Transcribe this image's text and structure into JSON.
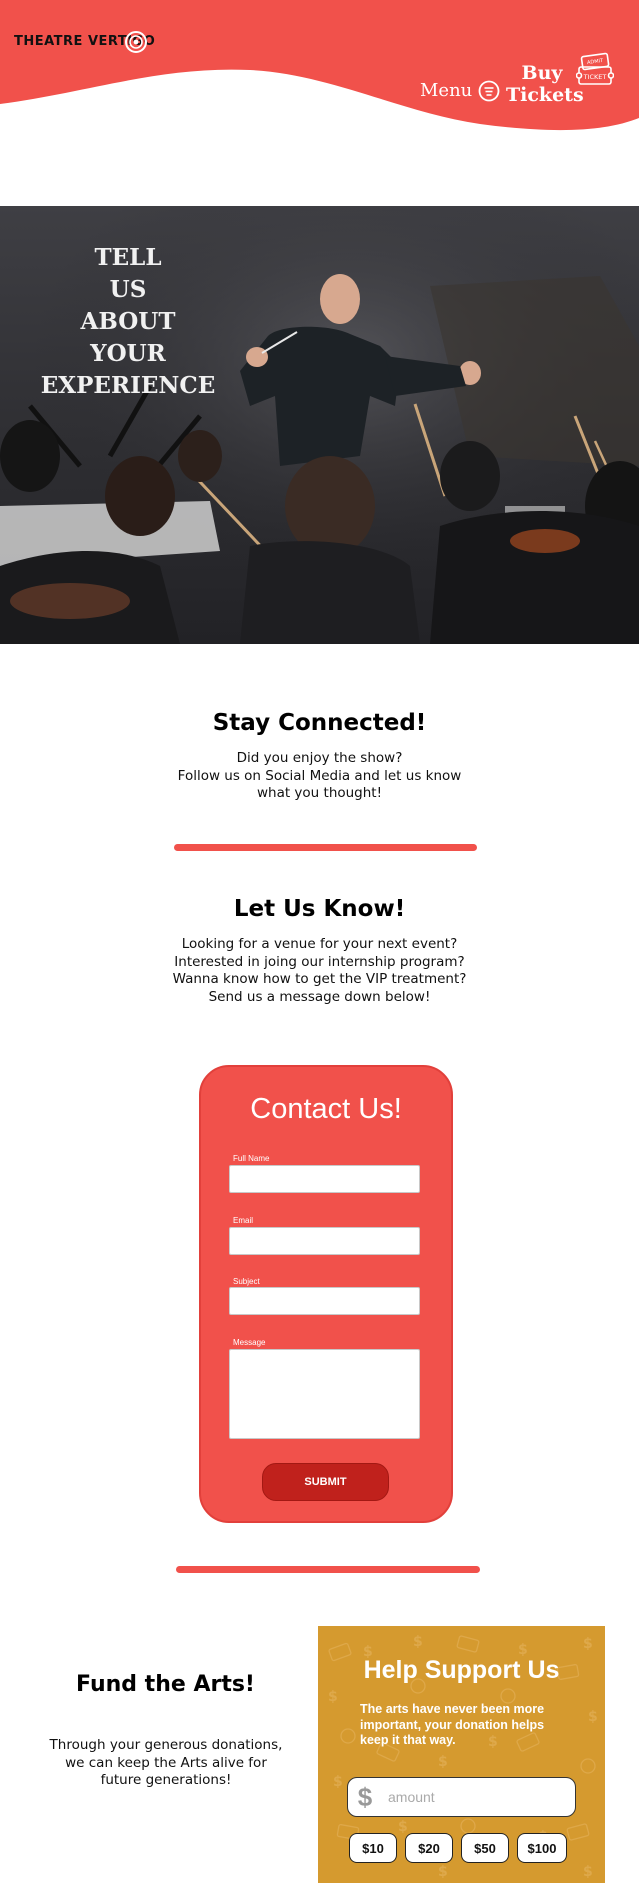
{
  "header": {
    "logo_text": "THEATRE VERTIGO",
    "menu_label": "Menu",
    "tickets_line1": "Buy",
    "tickets_line2": "Tickets",
    "ticket_icon_text_top": "ADMIT",
    "ticket_icon_text_bottom": "TICKET"
  },
  "hero": {
    "title_lines": [
      "TELL",
      "US",
      "ABOUT",
      "YOUR",
      "EXPERIENCE"
    ]
  },
  "stay_connected": {
    "heading": "Stay Connected!",
    "lines": [
      "Did you enjoy the show?",
      "Follow us on Social Media and let us know",
      "what you thought!"
    ]
  },
  "let_us_know": {
    "heading": "Let Us Know!",
    "lines": [
      "Looking for a venue for your next event?",
      "Interested in joing our internship program?",
      "Wanna know how to get the VIP treatment?",
      "Send us a message down below!"
    ]
  },
  "contact": {
    "heading": "Contact Us!",
    "full_name_label": "Full Name",
    "email_label": "Email",
    "subject_label": "Subject",
    "message_label": "Message",
    "submit_label": "SUBMIT"
  },
  "fund": {
    "heading": "Fund the Arts!",
    "lines": [
      "Through your generous donations,",
      "we can keep the Arts alive for",
      "future generations!"
    ]
  },
  "support": {
    "heading": "Help Support Us",
    "text": "The arts have never been more important, your donation helps keep it that way.",
    "currency_symbol": "$",
    "amount_placeholder": "amount",
    "amounts": [
      "$10",
      "$20",
      "$50",
      "$100"
    ]
  },
  "colors": {
    "brand_red": "#f1514b",
    "submit_red": "#c0211c",
    "support_gold": "#d59a2f"
  }
}
